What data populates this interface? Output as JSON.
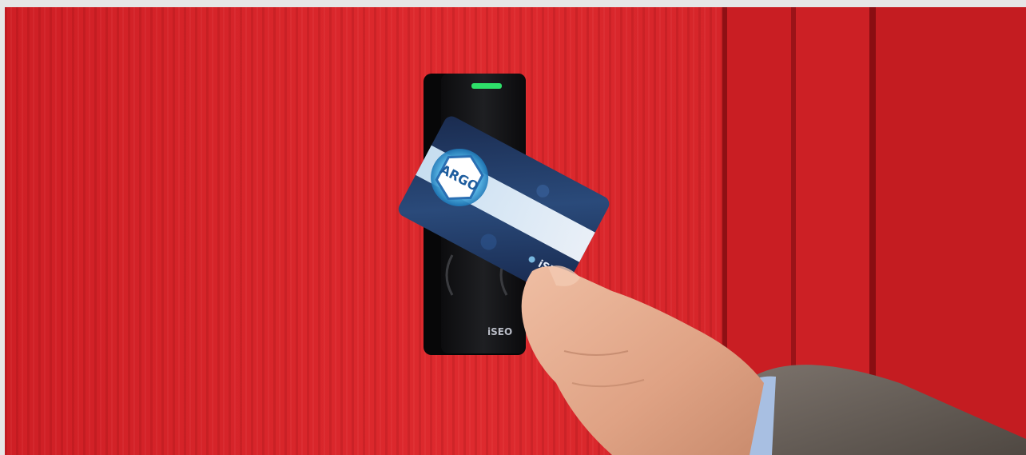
{
  "photo": {
    "card_label": "ARGO",
    "card_brand": "iSEO",
    "reader_brand": "iSEO",
    "colors": {
      "wall": "#d8242a",
      "wall_dark": "#a8151b",
      "reader": "#141416",
      "led": "#2ee06a",
      "card": "#243a64",
      "card_glow": "#7fd4ff",
      "skin": "#e2a98a",
      "shirt_cuff": "#9fb7dc",
      "sleeve": "#6f6660"
    }
  }
}
